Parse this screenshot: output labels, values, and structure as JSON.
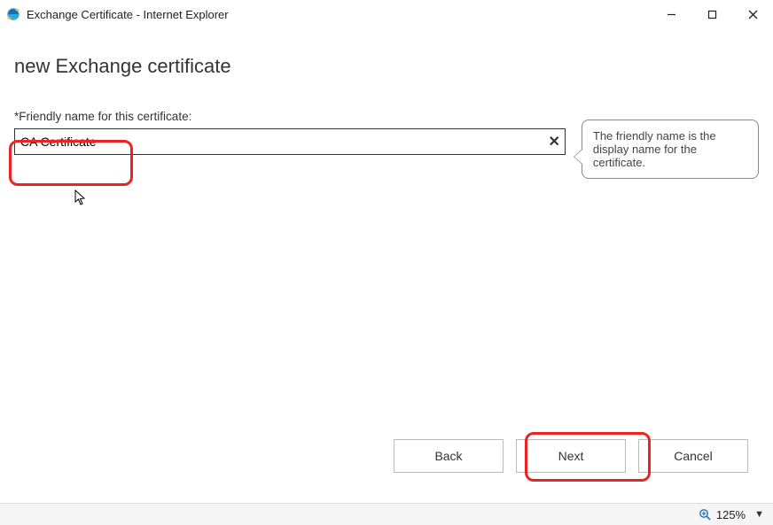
{
  "window": {
    "title": "Exchange Certificate - Internet Explorer"
  },
  "page": {
    "heading": "new Exchange certificate",
    "field_label": "*Friendly name for this certificate:",
    "input_value": "CA Certificate",
    "tooltip": "The friendly name is the display name for the certificate."
  },
  "buttons": {
    "back": "Back",
    "next": "Next",
    "cancel": "Cancel"
  },
  "status": {
    "zoom": "125%"
  }
}
